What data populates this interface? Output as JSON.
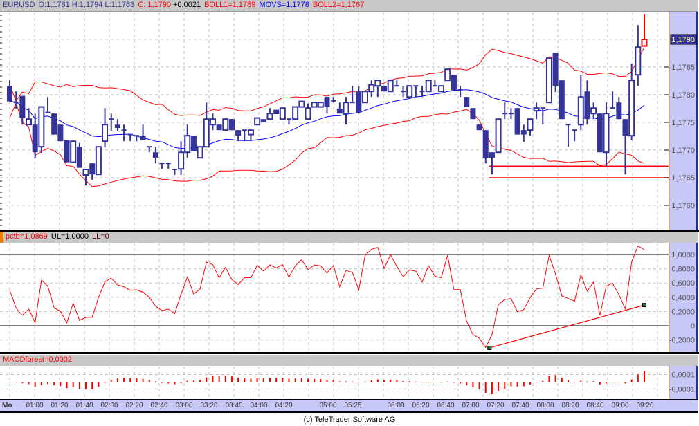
{
  "header": {
    "symbol": "EURUSD",
    "ohl": "O:1,1781 H:1,1794 L:1,1763",
    "close": "C: 1,1790",
    "change": "+0,0021",
    "boll1": "BOLL1=1,1789",
    "movs": "MOVS=1,1778",
    "boll2": "BOLL2=1,1767"
  },
  "price_axis": {
    "ticks": [
      {
        "value": 1.1785,
        "label": "1,1785"
      },
      {
        "value": 1.178,
        "label": "1,1780"
      },
      {
        "value": 1.1775,
        "label": "1,1775"
      },
      {
        "value": 1.177,
        "label": "1,1770"
      },
      {
        "value": 1.1765,
        "label": "1,1765"
      },
      {
        "value": 1.176,
        "label": "1,1760"
      }
    ],
    "current_value": 1.179,
    "current_label": "1,1790"
  },
  "pctb": {
    "name": "pctb=1,0869",
    "ul": "UL=1,0000",
    "ll": "LL=0",
    "ticks": [
      {
        "value": 1.0,
        "label": "1,0000"
      },
      {
        "value": 0.8,
        "label": "0,8000"
      },
      {
        "value": 0.6,
        "label": "0,6000"
      },
      {
        "value": 0.4,
        "label": "0,4000"
      },
      {
        "value": 0.2,
        "label": "0,2000"
      },
      {
        "value": 0.0,
        "label": "0"
      },
      {
        "value": -0.2,
        "label": "-0,2000"
      }
    ]
  },
  "macd": {
    "name": "MACDforest=0,0002",
    "ticks": [
      {
        "value": 0.0001,
        "label": "0,0001"
      },
      {
        "value": -0.0001,
        "label": "-0,0001"
      }
    ]
  },
  "time_axis": {
    "day": "Mo",
    "labels": [
      "01:00",
      "01:20",
      "01:40",
      "02:00",
      "02:20",
      "02:40",
      "03:00",
      "03:20",
      "03:40",
      "04:00",
      "04:20",
      "05:00",
      "05:25",
      "06:00",
      "06:20",
      "06:40",
      "07:00",
      "07:20",
      "07:40",
      "08:00",
      "08:20",
      "08:40",
      "09:00",
      "09:20"
    ]
  },
  "footer": "(c) TeleTrader Software AG",
  "colors": {
    "candle": "#333399",
    "band": "#ff0000",
    "ma": "#0000ff",
    "last": "#ff0000"
  },
  "chart_data": {
    "type": "candlestick",
    "title": "EURUSD",
    "ylim": [
      1.1755,
      1.1797
    ],
    "candle_format": [
      "open",
      "high",
      "low",
      "close"
    ],
    "candles": [
      [
        1.17816,
        1.17826,
        1.17788,
        1.17788
      ],
      [
        1.17786,
        1.17806,
        1.17775,
        1.17786
      ],
      [
        1.17798,
        1.17798,
        1.17746,
        1.17758
      ],
      [
        1.17746,
        1.17776,
        1.17746,
        1.17756
      ],
      [
        1.17746,
        1.17766,
        1.17685,
        1.17696
      ],
      [
        1.17706,
        1.17778,
        1.17695,
        1.17778
      ],
      [
        1.17768,
        1.17796,
        1.17768,
        1.17768
      ],
      [
        1.17766,
        1.17766,
        1.17728,
        1.17728
      ],
      [
        1.17746,
        1.17746,
        1.17716,
        1.17716
      ],
      [
        1.17718,
        1.17718,
        1.17678,
        1.17678
      ],
      [
        1.17678,
        1.17716,
        1.17678,
        1.17716
      ],
      [
        1.17706,
        1.17713,
        1.17668,
        1.17668
      ],
      [
        1.17655,
        1.17665,
        1.17636,
        1.17665
      ],
      [
        1.17676,
        1.17676,
        1.17646,
        1.17656
      ],
      [
        1.17656,
        1.17706,
        1.17656,
        1.17706
      ],
      [
        1.17716,
        1.17776,
        1.17705,
        1.17746
      ],
      [
        1.17756,
        1.17766,
        1.17735,
        1.17756
      ],
      [
        1.17746,
        1.17756,
        1.17735,
        1.1774
      ],
      [
        1.17736,
        1.17746,
        1.17716,
        1.17736
      ],
      [
        1.17728,
        1.17728,
        1.17716,
        1.17728
      ],
      [
        1.17726,
        1.17726,
        1.17716,
        1.17726
      ],
      [
        1.17726,
        1.17746,
        1.17718,
        1.17718
      ],
      [
        1.17706,
        1.17706,
        1.17696,
        1.17706
      ],
      [
        1.17696,
        1.17706,
        1.17676,
        1.17686
      ],
      [
        1.17676,
        1.17676,
        1.17666,
        1.17676
      ],
      [
        1.17676,
        1.17676,
        1.17666,
        1.17676
      ],
      [
        1.17665,
        1.17665,
        1.17655,
        1.17665
      ],
      [
        1.17666,
        1.17716,
        1.17655,
        1.17696
      ],
      [
        1.17696,
        1.17746,
        1.17686,
        1.17726
      ],
      [
        1.17726,
        1.17726,
        1.17698,
        1.17698
      ],
      [
        1.17686,
        1.17706,
        1.17686,
        1.17706
      ],
      [
        1.17706,
        1.17786,
        1.17706,
        1.17756
      ],
      [
        1.17746,
        1.17766,
        1.17736,
        1.17756
      ],
      [
        1.17746,
        1.17746,
        1.17736,
        1.17736
      ],
      [
        1.17736,
        1.17756,
        1.17736,
        1.17756
      ],
      [
        1.17756,
        1.17756,
        1.17736,
        1.17736
      ],
      [
        1.17736,
        1.17736,
        1.17716,
        1.17726
      ],
      [
        1.17736,
        1.17736,
        1.17716,
        1.17736
      ],
      [
        1.17728,
        1.17736,
        1.17716,
        1.17736
      ],
      [
        1.17746,
        1.17758,
        1.17746,
        1.17758
      ],
      [
        1.17756,
        1.17756,
        1.17751,
        1.17751
      ],
      [
        1.17756,
        1.17776,
        1.17756,
        1.17766
      ],
      [
        1.17773,
        1.17773,
        1.17765,
        1.17765
      ],
      [
        1.17756,
        1.17776,
        1.17756,
        1.17776
      ],
      [
        1.17756,
        1.17756,
        1.17746,
        1.17756
      ],
      [
        1.17756,
        1.17778,
        1.17756,
        1.17778
      ],
      [
        1.17778,
        1.17788,
        1.17778,
        1.17788
      ],
      [
        1.17756,
        1.17784,
        1.17756,
        1.17776
      ],
      [
        1.17778,
        1.17786,
        1.17778,
        1.17786
      ],
      [
        1.17778,
        1.17786,
        1.17778,
        1.17786
      ],
      [
        1.17796,
        1.17796,
        1.17766,
        1.17778
      ],
      [
        1.17789,
        1.17796,
        1.17786,
        1.17789
      ],
      [
        1.17775,
        1.17786,
        1.17766,
        1.17766
      ],
      [
        1.17766,
        1.17796,
        1.17746,
        1.17786
      ],
      [
        1.17786,
        1.17816,
        1.17786,
        1.17786
      ],
      [
        1.17806,
        1.17815,
        1.17766,
        1.17768
      ],
      [
        1.17786,
        1.17806,
        1.17786,
        1.17806
      ],
      [
        1.17806,
        1.17826,
        1.17796,
        1.17818
      ],
      [
        1.17816,
        1.17826,
        1.17796,
        1.17826
      ],
      [
        1.17816,
        1.17816,
        1.17806,
        1.17806
      ],
      [
        1.17806,
        1.17826,
        1.17806,
        1.17826
      ],
      [
        1.17816,
        1.17826,
        1.17816,
        1.17816
      ],
      [
        1.17806,
        1.17816,
        1.17796,
        1.17806
      ],
      [
        1.17796,
        1.17816,
        1.17796,
        1.17816
      ],
      [
        1.17816,
        1.17816,
        1.17796,
        1.17816
      ],
      [
        1.17806,
        1.17816,
        1.17796,
        1.17806
      ],
      [
        1.17806,
        1.17826,
        1.17806,
        1.17826
      ],
      [
        1.17816,
        1.17826,
        1.17816,
        1.17816
      ],
      [
        1.17806,
        1.17816,
        1.17806,
        1.17816
      ],
      [
        1.17826,
        1.17846,
        1.17826,
        1.17846
      ],
      [
        1.17836,
        1.17836,
        1.17808,
        1.17808
      ],
      [
        1.17809,
        1.17816,
        1.17796,
        1.17809
      ],
      [
        1.17796,
        1.17796,
        1.17778,
        1.17778
      ],
      [
        1.17776,
        1.17776,
        1.17756,
        1.17756
      ],
      [
        1.17746,
        1.17746,
        1.17736,
        1.17736
      ],
      [
        1.17736,
        1.17736,
        1.17676,
        1.17686
      ],
      [
        1.17696,
        1.17696,
        1.17656,
        1.17686
      ],
      [
        1.17696,
        1.17756,
        1.17696,
        1.17756
      ],
      [
        1.17766,
        1.17786,
        1.17756,
        1.17766
      ],
      [
        1.17766,
        1.17776,
        1.17756,
        1.17766
      ],
      [
        1.17776,
        1.17776,
        1.17728,
        1.17728
      ],
      [
        1.17736,
        1.17746,
        1.17715,
        1.17728
      ],
      [
        1.17736,
        1.17756,
        1.17726,
        1.17756
      ],
      [
        1.17771,
        1.17786,
        1.17756,
        1.17776
      ],
      [
        1.17776,
        1.17776,
        1.17746,
        1.17776
      ],
      [
        1.17786,
        1.17866,
        1.17786,
        1.17866
      ],
      [
        1.17876,
        1.17876,
        1.17805,
        1.17816
      ],
      [
        1.17826,
        1.17826,
        1.17756,
        1.17756
      ],
      [
        1.17746,
        1.17746,
        1.17706,
        1.17746
      ],
      [
        1.17736,
        1.17736,
        1.17716,
        1.17736
      ],
      [
        1.17746,
        1.17836,
        1.17736,
        1.17796
      ],
      [
        1.17806,
        1.17826,
        1.17746,
        1.17756
      ],
      [
        1.17766,
        1.17786,
        1.17756,
        1.17776
      ],
      [
        1.17766,
        1.17766,
        1.17696,
        1.17696
      ],
      [
        1.17696,
        1.17786,
        1.17671,
        1.17766
      ],
      [
        1.17776,
        1.17806,
        1.17776,
        1.17776
      ],
      [
        1.17786,
        1.17796,
        1.17756,
        1.17756
      ],
      [
        1.17756,
        1.17756,
        1.17656,
        1.17726
      ],
      [
        1.17726,
        1.17856,
        1.17718,
        1.17826
      ],
      [
        1.17836,
        1.17926,
        1.17816,
        1.17886
      ],
      [
        1.17888,
        1.17946,
        1.17888,
        1.179
      ]
    ],
    "bollinger": {
      "period": 20,
      "stddev": 2
    },
    "support_lines": [
      {
        "from_index": 76,
        "price": 1.17671
      },
      {
        "from_index": 76,
        "price": 1.1765
      }
    ],
    "pctb_trendline": [
      [
        75.6,
        -0.31
      ],
      [
        100,
        0.29
      ]
    ],
    "pctb_levels": [
      1.0,
      0.0
    ]
  }
}
